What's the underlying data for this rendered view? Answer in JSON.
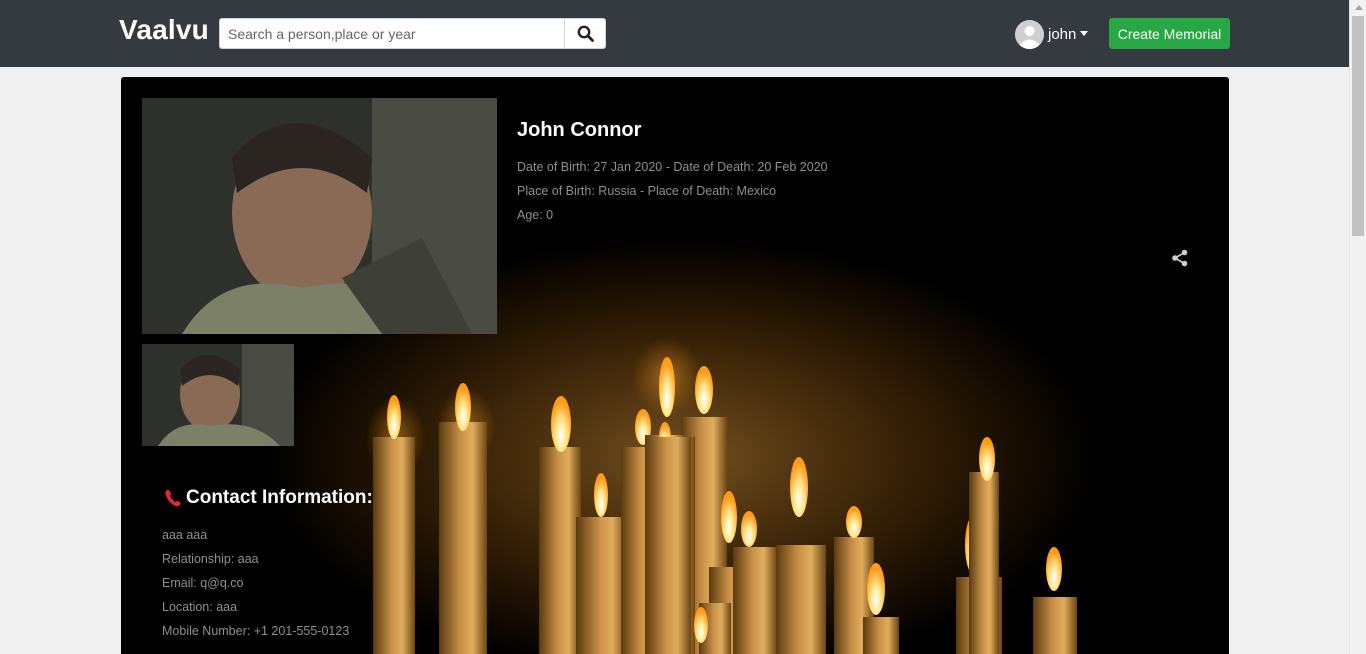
{
  "navbar": {
    "brand": "Vaalvu",
    "search_placeholder": "Search a person,place or year",
    "search_icon": "search-icon",
    "user_name": "john",
    "create_label": "Create Memorial"
  },
  "memorial": {
    "name": "John Connor",
    "dates": "Date of Birth: 27 Jan 2020 - Date of Death: 20 Feb 2020",
    "places": "Place of Birth: Russia - Place of Death: Mexico",
    "age": "Age: 0"
  },
  "contact": {
    "icon": "phone-icon",
    "title": "Contact Information:",
    "name": "aaa aaa",
    "relationship": "Relationship: aaa",
    "email": "Email: q@q.co",
    "location": "Location: aaa",
    "mobile": "Mobile Number: +1 201-555-0123"
  },
  "colors": {
    "navbar": "#343a40",
    "accent_green": "#28a745",
    "card_bg": "#000000",
    "muted_text": "#8f8f8f"
  }
}
